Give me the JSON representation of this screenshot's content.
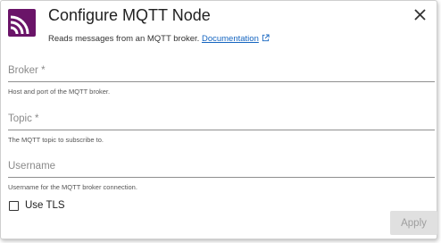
{
  "dialog": {
    "title": "Configure MQTT Node",
    "description": "Reads messages from an MQTT broker.",
    "doc_link": "Documentation",
    "brand_color": "#6a1468",
    "logo_icon": "rss-feed-icon",
    "close_icon": "close-icon"
  },
  "fields": [
    {
      "label": "Broker *",
      "value": "",
      "help": "Host and port of the MQTT broker."
    },
    {
      "label": "Topic *",
      "value": "",
      "help": "The MQTT topic to subscribe to."
    },
    {
      "label": "Username",
      "value": "",
      "help": "Username for the MQTT broker connection."
    }
  ],
  "tls": {
    "label": "Use TLS",
    "checked": false
  },
  "actions": {
    "apply_label": "Apply",
    "apply_enabled": false
  }
}
